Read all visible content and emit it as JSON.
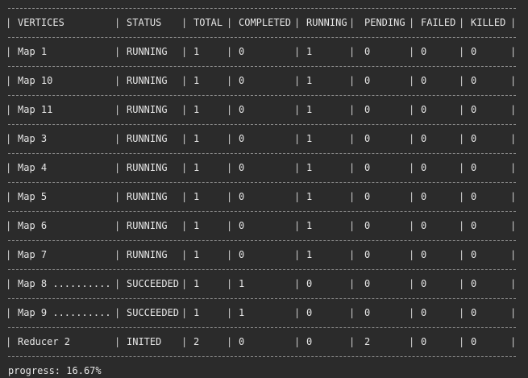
{
  "columns": [
    "VERTICES",
    "STATUS",
    "TOTAL",
    "COMPLETED",
    "RUNNING",
    "PENDING",
    "FAILED",
    "KILLED"
  ],
  "rows": [
    [
      "Map 1",
      "RUNNING",
      "1",
      "0",
      "1",
      "0",
      "0",
      "0"
    ],
    [
      "Map 10",
      "RUNNING",
      "1",
      "0",
      "1",
      "0",
      "0",
      "0"
    ],
    [
      "Map 11",
      "RUNNING",
      "1",
      "0",
      "1",
      "0",
      "0",
      "0"
    ],
    [
      "Map 3",
      "RUNNING",
      "1",
      "0",
      "1",
      "0",
      "0",
      "0"
    ],
    [
      "Map 4",
      "RUNNING",
      "1",
      "0",
      "1",
      "0",
      "0",
      "0"
    ],
    [
      "Map 5",
      "RUNNING",
      "1",
      "0",
      "1",
      "0",
      "0",
      "0"
    ],
    [
      "Map 6",
      "RUNNING",
      "1",
      "0",
      "1",
      "0",
      "0",
      "0"
    ],
    [
      "Map 7",
      "RUNNING",
      "1",
      "0",
      "1",
      "0",
      "0",
      "0"
    ],
    [
      "Map 8 ..........",
      "SUCCEEDED",
      "1",
      "1",
      "0",
      "0",
      "0",
      "0"
    ],
    [
      "Map 9 ..........",
      "SUCCEEDED",
      "1",
      "1",
      "0",
      "0",
      "0",
      "0"
    ],
    [
      "Reducer 2",
      "INITED",
      "2",
      "0",
      "0",
      "2",
      "0",
      "0"
    ]
  ],
  "progress": {
    "label": "progress:",
    "value": "16.67%"
  },
  "colors": {
    "background": "#2b2b2b",
    "text": "#e6e6e6",
    "border": "#8a8a8a"
  }
}
